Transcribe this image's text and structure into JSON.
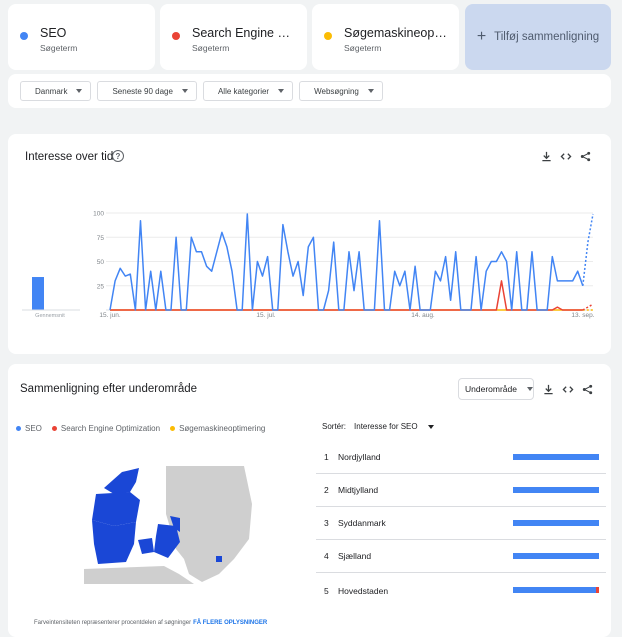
{
  "terms": [
    {
      "name": "SEO",
      "sub": "Søgeterm",
      "color": "#4285f4"
    },
    {
      "name": "Search Engine Op...",
      "sub": "Søgeterm",
      "color": "#ea4335"
    },
    {
      "name": "Søgemaskineopti...",
      "sub": "Søgeterm",
      "color": "#fbbc04"
    }
  ],
  "add_compare": "Tilføj sammenligning",
  "filters": [
    "Danmark",
    "Seneste 90 dage",
    "Alle kategorier",
    "Websøgning"
  ],
  "interest": {
    "title": "Interesse over tid",
    "avg_label": "Gennemsnit",
    "y_ticks": [
      "100",
      "75",
      "50",
      "25"
    ],
    "x_ticks": [
      "15. jun.",
      "15. jul.",
      "14. aug.",
      "13. sep."
    ]
  },
  "chart_data": {
    "type": "line",
    "y_range": [
      0,
      100
    ],
    "x_labels": [
      "15. jun.",
      "15. jul.",
      "14. aug.",
      "13. sep."
    ],
    "series": [
      {
        "name": "SEO",
        "color": "#4285f4",
        "values": [
          0,
          30,
          43,
          35,
          37,
          0,
          92,
          0,
          40,
          0,
          40,
          0,
          0,
          75,
          0,
          0,
          75,
          60,
          60,
          45,
          40,
          60,
          80,
          65,
          40,
          0,
          0,
          99,
          0,
          50,
          35,
          55,
          0,
          0,
          88,
          60,
          35,
          50,
          15,
          65,
          75,
          0,
          0,
          20,
          70,
          0,
          0,
          60,
          20,
          60,
          0,
          0,
          0,
          92,
          0,
          0,
          40,
          25,
          40,
          0,
          45,
          0,
          0,
          0,
          40,
          30,
          55,
          10,
          60,
          0,
          0,
          0,
          55,
          0,
          40,
          50,
          50,
          60,
          50,
          0,
          60,
          0,
          0,
          60,
          0,
          0,
          0,
          55,
          30,
          30,
          30,
          30,
          40,
          25,
          70,
          99
        ]
      },
      {
        "name": "Search Engine Optimization",
        "color": "#ea4335",
        "values": [
          0,
          0,
          0,
          0,
          0,
          0,
          0,
          0,
          0,
          0,
          0,
          0,
          0,
          0,
          0,
          0,
          0,
          0,
          0,
          0,
          0,
          0,
          0,
          0,
          0,
          0,
          0,
          0,
          0,
          0,
          0,
          0,
          0,
          0,
          0,
          0,
          0,
          0,
          0,
          0,
          0,
          0,
          0,
          0,
          0,
          0,
          0,
          0,
          0,
          0,
          0,
          0,
          0,
          0,
          0,
          0,
          0,
          0,
          0,
          0,
          0,
          0,
          0,
          0,
          0,
          0,
          0,
          0,
          0,
          0,
          0,
          0,
          0,
          0,
          0,
          0,
          0,
          30,
          0,
          0,
          0,
          0,
          0,
          0,
          0,
          0,
          0,
          0,
          3,
          0,
          0,
          0,
          0,
          0,
          3,
          6
        ]
      },
      {
        "name": "Søgemaskineoptimering",
        "color": "#fbbc04",
        "values": [
          0,
          0,
          0,
          0,
          0,
          0,
          0,
          0,
          0,
          0,
          0,
          0,
          0,
          0,
          0,
          0,
          0,
          0,
          0,
          0,
          0,
          0,
          0,
          0,
          0,
          0,
          0,
          0,
          0,
          0,
          0,
          0,
          0,
          0,
          0,
          0,
          0,
          0,
          0,
          0,
          0,
          0,
          0,
          0,
          0,
          0,
          0,
          0,
          0,
          0,
          0,
          0,
          0,
          0,
          0,
          0,
          0,
          0,
          0,
          0,
          0,
          0,
          0,
          0,
          0,
          0,
          0,
          0,
          0,
          0,
          0,
          0,
          0,
          0,
          0,
          0,
          0,
          0,
          0,
          0,
          0,
          0,
          0,
          0,
          0,
          0,
          0,
          0,
          0,
          0,
          0,
          0,
          0,
          0,
          0,
          0
        ]
      }
    ],
    "averages": [
      34,
      0,
      0
    ]
  },
  "region": {
    "title": "Sammenligning efter underområde",
    "dropdown": "Underområde",
    "legend": [
      "SEO",
      "Search Engine Optimization",
      "Søgemaskineoptimering"
    ],
    "sort_label": "Sortér:",
    "sort_value": "Interesse for SEO",
    "rows": [
      {
        "rank": "1",
        "name": "Nordjylland",
        "seo": 100,
        "seo_pct": 1.0,
        "other_pct": 0
      },
      {
        "rank": "2",
        "name": "Midtjylland",
        "seo": 100,
        "seo_pct": 1.0,
        "other_pct": 0
      },
      {
        "rank": "3",
        "name": "Syddanmark",
        "seo": 100,
        "seo_pct": 1.0,
        "other_pct": 0
      },
      {
        "rank": "4",
        "name": "Sjælland",
        "seo": 100,
        "seo_pct": 1.0,
        "other_pct": 0
      },
      {
        "rank": "5",
        "name": "Hovedstaden",
        "seo": 97,
        "seo_pct": 0.97,
        "other_pct": 0.03
      }
    ],
    "footnote": "Farveintensiteten repræsenterer procentdelen af søgninger",
    "footnote_link": "FÅ FLERE OPLYSNINGER"
  }
}
